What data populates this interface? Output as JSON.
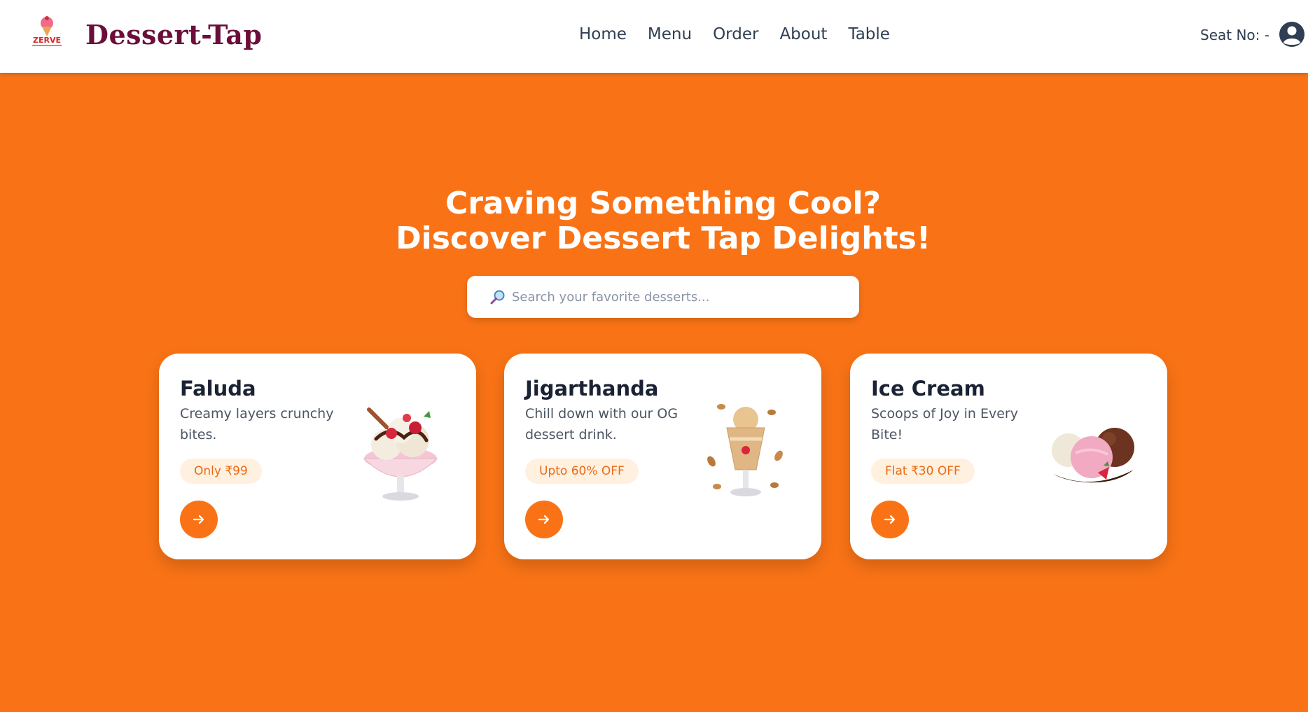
{
  "brand": {
    "title": "Dessert-Tap",
    "logo_text": "ZERVE"
  },
  "nav": {
    "items": [
      "Home",
      "Menu",
      "Order",
      "About",
      "Table"
    ]
  },
  "seat": {
    "label": "Seat No: -"
  },
  "hero": {
    "title_line1": "Craving Something Cool?",
    "title_line2": "Discover Dessert Tap Delights!"
  },
  "search": {
    "placeholder": "Search your favorite desserts...",
    "value": ""
  },
  "cards": [
    {
      "title": "Faluda",
      "description": "Creamy layers crunchy bites.",
      "badge": "Only ₹99",
      "image_icon": "faluda-sundae-image"
    },
    {
      "title": "Jigarthanda",
      "description": "Chill down with our OG dessert drink.",
      "badge": "Upto 60% OFF",
      "image_icon": "jigarthanda-drink-image"
    },
    {
      "title": "Ice Cream",
      "description": "Scoops of Joy in Every Bite!",
      "badge": "Flat ₹30 OFF",
      "image_icon": "ice-cream-scoops-image"
    }
  ],
  "colors": {
    "background": "#f97316",
    "brand_title": "#6b0f3a",
    "accent": "#f97316",
    "badge_bg": "#fff0e0",
    "badge_text": "#ea6a14"
  },
  "icons": {
    "logo": "ice-cream-cone-icon",
    "search": "magnifier-icon",
    "user": "user-circle-icon",
    "arrow": "arrow-right-icon"
  }
}
